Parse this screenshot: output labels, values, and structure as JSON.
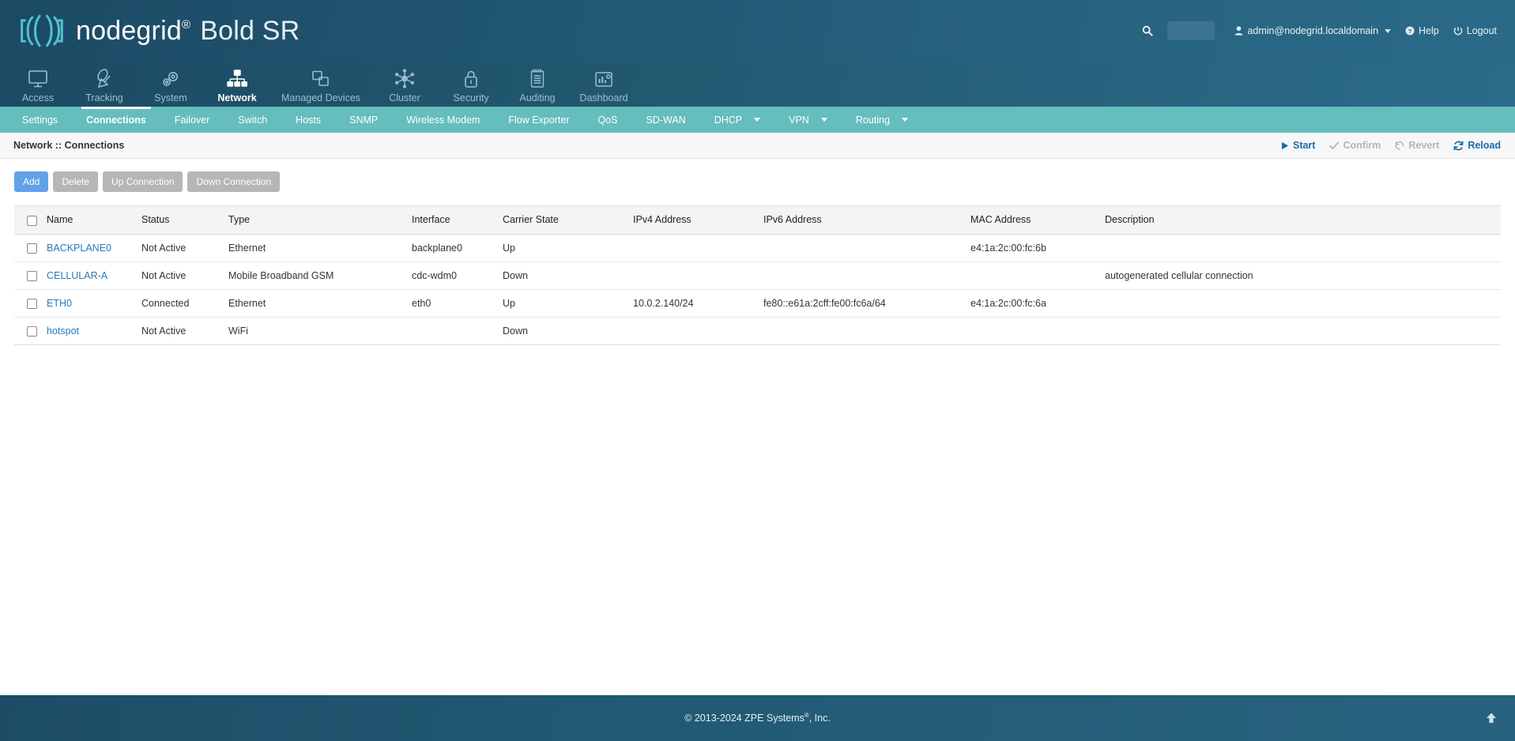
{
  "header": {
    "brand_name": "nodegrid",
    "brand_reg": "®",
    "brand_model": "Bold SR",
    "search_icon": "search-icon",
    "search_value": "",
    "user_icon": "user-icon",
    "user_label": "admin@nodegrid.localdomain",
    "help_icon": "help-circle-icon",
    "help_label": "Help",
    "logout_icon": "power-icon",
    "logout_label": "Logout"
  },
  "main_nav": {
    "items": [
      {
        "label": "Access",
        "icon": "monitor-icon",
        "active": false
      },
      {
        "label": "Tracking",
        "icon": "satellite-icon",
        "active": false
      },
      {
        "label": "System",
        "icon": "gears-icon",
        "active": false
      },
      {
        "label": "Network",
        "icon": "sitemap-icon",
        "active": true
      },
      {
        "label": "Managed Devices",
        "icon": "layers-icon",
        "active": false
      },
      {
        "label": "Cluster",
        "icon": "cluster-icon",
        "active": false
      },
      {
        "label": "Security",
        "icon": "lock-icon",
        "active": false
      },
      {
        "label": "Auditing",
        "icon": "notepad-icon",
        "active": false
      },
      {
        "label": "Dashboard",
        "icon": "bar-chart-icon",
        "active": false
      }
    ]
  },
  "sub_nav": {
    "items": [
      {
        "label": "Settings",
        "active": false,
        "caret": false
      },
      {
        "label": "Connections",
        "active": true,
        "caret": false
      },
      {
        "label": "Failover",
        "active": false,
        "caret": false
      },
      {
        "label": "Switch",
        "active": false,
        "caret": false
      },
      {
        "label": "Hosts",
        "active": false,
        "caret": false
      },
      {
        "label": "SNMP",
        "active": false,
        "caret": false
      },
      {
        "label": "Wireless Modem",
        "active": false,
        "caret": false
      },
      {
        "label": "Flow Exporter",
        "active": false,
        "caret": false
      },
      {
        "label": "QoS",
        "active": false,
        "caret": false
      },
      {
        "label": "SD-WAN",
        "active": false,
        "caret": false
      },
      {
        "label": "DHCP",
        "active": false,
        "caret": true
      },
      {
        "label": "VPN",
        "active": false,
        "caret": true
      },
      {
        "label": "Routing",
        "active": false,
        "caret": true
      }
    ]
  },
  "breadcrumb": {
    "title": "Network :: Connections",
    "actions": [
      {
        "label": "Start",
        "icon": "play-icon",
        "disabled": false
      },
      {
        "label": "Confirm",
        "icon": "check-icon",
        "disabled": true
      },
      {
        "label": "Revert",
        "icon": "undo-icon",
        "disabled": true
      },
      {
        "label": "Reload",
        "icon": "refresh-icon",
        "disabled": false
      }
    ]
  },
  "toolbar": {
    "buttons": [
      {
        "label": "Add",
        "style": "primary"
      },
      {
        "label": "Delete",
        "style": "muted"
      },
      {
        "label": "Up Connection",
        "style": "muted"
      },
      {
        "label": "Down Connection",
        "style": "muted"
      }
    ]
  },
  "table": {
    "columns": [
      "Name",
      "Status",
      "Type",
      "Interface",
      "Carrier State",
      "IPv4 Address",
      "IPv6 Address",
      "MAC Address",
      "Description"
    ],
    "select_all_checked": false,
    "rows": [
      {
        "checked": false,
        "name": "BACKPLANE0",
        "status": "Not Active",
        "type": "Ethernet",
        "interface": "backplane0",
        "carrier_state": "Up",
        "ipv4": "",
        "ipv6": "",
        "mac": "e4:1a:2c:00:fc:6b",
        "description": ""
      },
      {
        "checked": false,
        "name": "CELLULAR-A",
        "status": "Not Active",
        "type": "Mobile Broadband GSM",
        "interface": "cdc-wdm0",
        "carrier_state": "Down",
        "ipv4": "",
        "ipv6": "",
        "mac": "",
        "description": "autogenerated cellular connection"
      },
      {
        "checked": false,
        "name": "ETH0",
        "status": "Connected",
        "type": "Ethernet",
        "interface": "eth0",
        "carrier_state": "Up",
        "ipv4": "10.0.2.140/24",
        "ipv6": "fe80::e61a:2cff:fe00:fc6a/64",
        "mac": "e4:1a:2c:00:fc:6a",
        "description": ""
      },
      {
        "checked": false,
        "name": "hotspot",
        "status": "Not Active",
        "type": "WiFi",
        "interface": "",
        "carrier_state": "Down",
        "ipv4": "",
        "ipv6": "",
        "mac": "",
        "description": ""
      }
    ]
  },
  "footer": {
    "copyright_pre": "© 2013-2024 ZPE Systems",
    "copyright_sup": "®",
    "copyright_post": ", Inc.",
    "to_top_icon": "arrow-up-icon"
  },
  "colors": {
    "header_dark": "#1c4a64",
    "header_light": "#2b6c8a",
    "subnav_teal": "#65bdbd",
    "accent_blue": "#1b6ca8",
    "link_blue": "#2a7ab9",
    "primary_button": "#63a1e8",
    "muted_button": "#b6b6b6",
    "brand_cyan": "#4fc3cd"
  }
}
